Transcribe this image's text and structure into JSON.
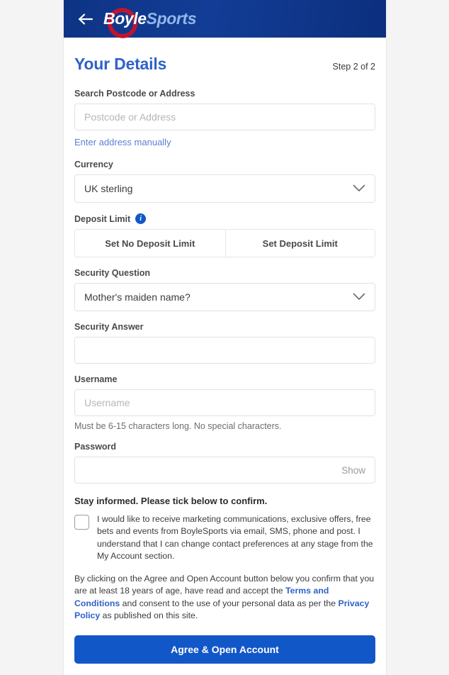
{
  "header": {
    "back_icon": "arrow-left-icon",
    "logo_primary": "Boyle",
    "logo_secondary": "Sports"
  },
  "heading": {
    "title": "Your Details",
    "step": "Step 2 of 2"
  },
  "postcode": {
    "label": "Search Postcode or Address",
    "placeholder": "Postcode or Address",
    "value": "",
    "manual_link": "Enter address manually"
  },
  "currency": {
    "label": "Currency",
    "selected": "UK sterling"
  },
  "deposit_limit": {
    "label": "Deposit Limit",
    "info_icon": "info-icon",
    "info_glyph": "i",
    "no_limit_label": "Set No Deposit Limit",
    "set_limit_label": "Set Deposit Limit"
  },
  "security_question": {
    "label": "Security Question",
    "selected": "Mother's maiden name?"
  },
  "security_answer": {
    "label": "Security Answer",
    "value": ""
  },
  "username": {
    "label": "Username",
    "placeholder": "Username",
    "value": "",
    "helper": "Must be 6-15 characters long. No special characters."
  },
  "password": {
    "label": "Password",
    "value": "",
    "show_label": "Show"
  },
  "marketing": {
    "title": "Stay informed. Please tick below to confirm.",
    "consent_text": "I would like to receive marketing communications, exclusive offers, free bets and events from BoyleSports via email, SMS, phone and post. I understand that I can change contact preferences at any stage from the My Account section.",
    "checked": false
  },
  "legal": {
    "part1": "By clicking on the Agree and Open Account button below you confirm that you are at least 18 years of age, have read and accept the ",
    "link1": "Terms and Conditions",
    "part2": " and consent to the use of your personal data as per the ",
    "link2": "Privacy Policy",
    "part3": " as published on this site."
  },
  "cta": {
    "label": "Agree & Open Account"
  },
  "colors": {
    "header_blue": "#123d96",
    "brand_red": "#c9132b",
    "accent_blue": "#2e62c8",
    "cta_blue": "#1257c8",
    "link_blue": "#5b7fd4"
  }
}
